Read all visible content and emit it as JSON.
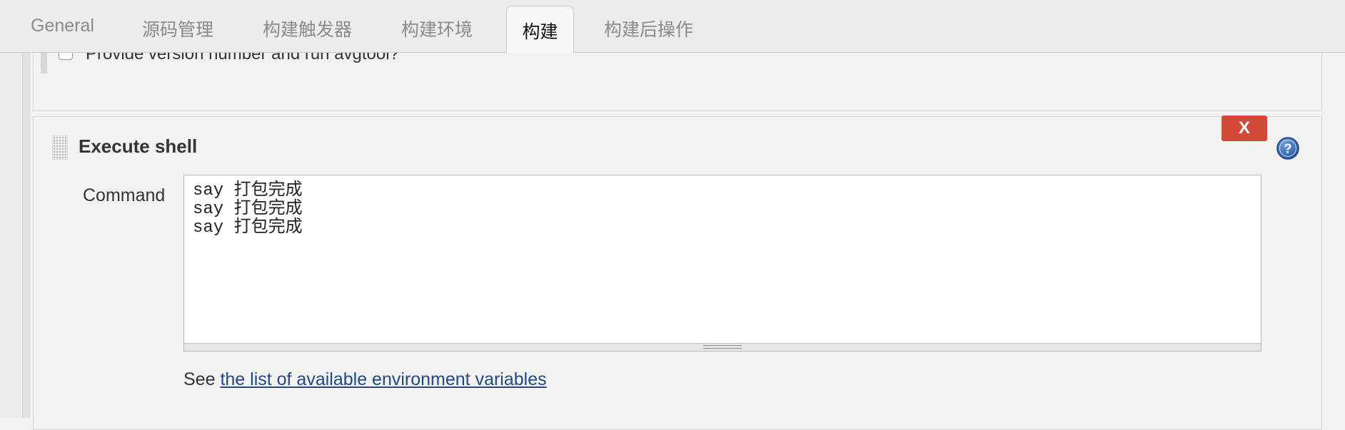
{
  "tabs": [
    {
      "label": "General",
      "active": false
    },
    {
      "label": "源码管理",
      "active": false
    },
    {
      "label": "构建触发器",
      "active": false
    },
    {
      "label": "构建环境",
      "active": false
    },
    {
      "label": "构建",
      "active": true
    },
    {
      "label": "构建后操作",
      "active": false
    }
  ],
  "previous_step": {
    "checkbox_label": "Provide version number and run avgtool?",
    "checked": false
  },
  "execute_shell": {
    "title": "Execute shell",
    "delete_label": "X",
    "command_label": "Command",
    "command_value": "say 打包完成\nsay 打包完成\nsay 打包完成",
    "see_prefix": "See ",
    "env_link_text": "the list of available environment variables",
    "help_icon": "help-icon"
  },
  "colors": {
    "delete_button": "#d24939",
    "link": "#204a87",
    "help_icon": "#2e67b8"
  }
}
